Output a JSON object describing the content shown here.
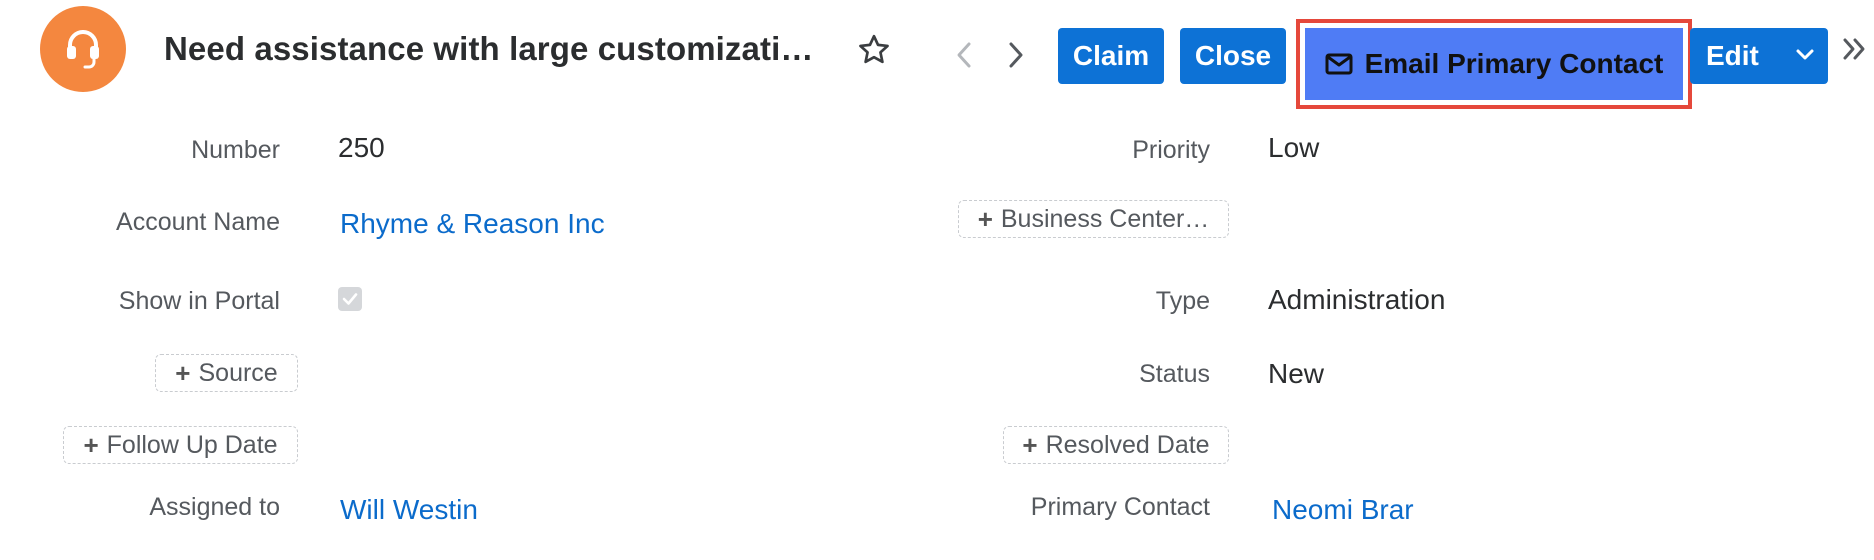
{
  "header": {
    "title": "Need assistance with large customizati…",
    "buttons": {
      "claim": "Claim",
      "close": "Close",
      "email": "Email Primary Contact",
      "edit": "Edit"
    },
    "icons": {
      "avatar": "headset-icon",
      "favorite": "star-icon",
      "prev": "chevron-left-icon",
      "next": "chevron-right-icon",
      "email": "envelope-icon",
      "edit_dropdown": "chevron-down-icon",
      "more": "double-chevron-right-icon"
    }
  },
  "left_fields": {
    "number": {
      "label": "Number",
      "value": "250"
    },
    "account_name": {
      "label": "Account Name",
      "value": "Rhyme & Reason Inc"
    },
    "show_in_portal": {
      "label": "Show in Portal",
      "checked": true
    },
    "source_add": "Source",
    "follow_up_add": "Follow Up Date",
    "assigned_to": {
      "label": "Assigned to",
      "value": "Will Westin"
    }
  },
  "right_fields": {
    "priority": {
      "label": "Priority",
      "value": "Low"
    },
    "business_center_add": "Business Center…",
    "type": {
      "label": "Type",
      "value": "Administration"
    },
    "status": {
      "label": "Status",
      "value": "New"
    },
    "resolved_add": "Resolved Date",
    "primary_contact": {
      "label": "Primary Contact",
      "value": "Neomi Brar"
    }
  },
  "colors": {
    "accent": "#0d72d6",
    "avatar": "#f4873f",
    "highlight_border": "#e5483b",
    "highlight_fill": "#4f7cf5",
    "link": "#0b6bcb"
  }
}
